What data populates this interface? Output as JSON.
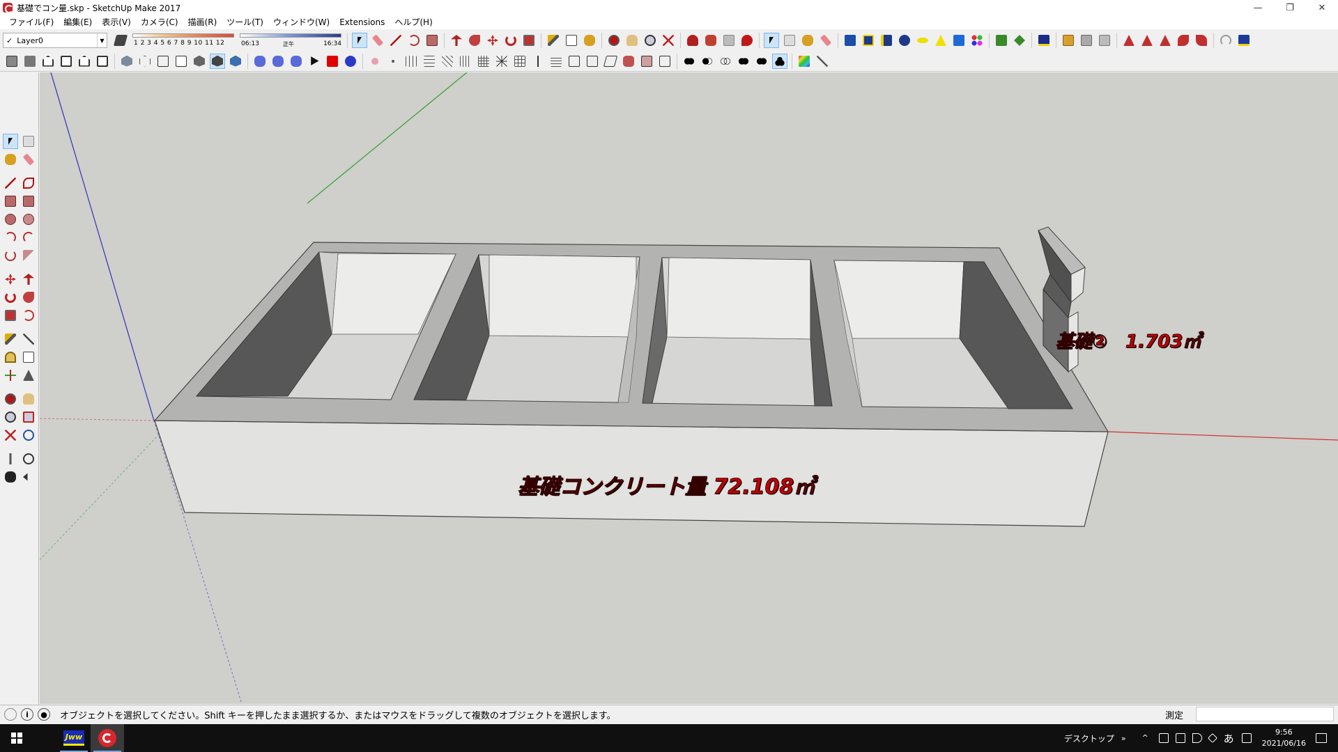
{
  "window": {
    "title": "基礎でコン量.skp - SketchUp Make 2017",
    "minimize": "—",
    "maximize": "❐",
    "close": "✕"
  },
  "menu": [
    "ファイル(F)",
    "編集(E)",
    "表示(V)",
    "カメラ(C)",
    "描画(R)",
    "ツール(T)",
    "ウィンドウ(W)",
    "Extensions",
    "ヘルプ(H)"
  ],
  "layer": {
    "check": "✓",
    "current": "Layer0"
  },
  "shadows": {
    "months": "1 2 3 4 5 6 7 8 9 10 11 12",
    "time_start": "06:13",
    "time_mid": "正午",
    "time_end": "16:34"
  },
  "viewport": {
    "label_main": "基礎コンクリート量 72.108㎥",
    "label_secondary": "基礎②　1.703㎥"
  },
  "status": {
    "message": "オブジェクトを選択してください。Shift キーを押したまま選択するか、またはマウスをドラッグして複数のオブジェクトを選択します。",
    "measure_label": "測定",
    "measure_value": ""
  },
  "taskbar": {
    "apps": [
      {
        "name": "jww",
        "label": "Jww"
      },
      {
        "name": "sketchup",
        "label": ""
      }
    ],
    "desktop_label": "デスクトップ",
    "chevron": "»",
    "ime": "あ",
    "time": "9:56",
    "date": "2021/06/16"
  },
  "colors": {
    "viewport_bg": "#cfcfcb",
    "label_red": "#c40000",
    "axis_red": "#d03030",
    "axis_green": "#30a030",
    "axis_blue": "#3030c0"
  }
}
